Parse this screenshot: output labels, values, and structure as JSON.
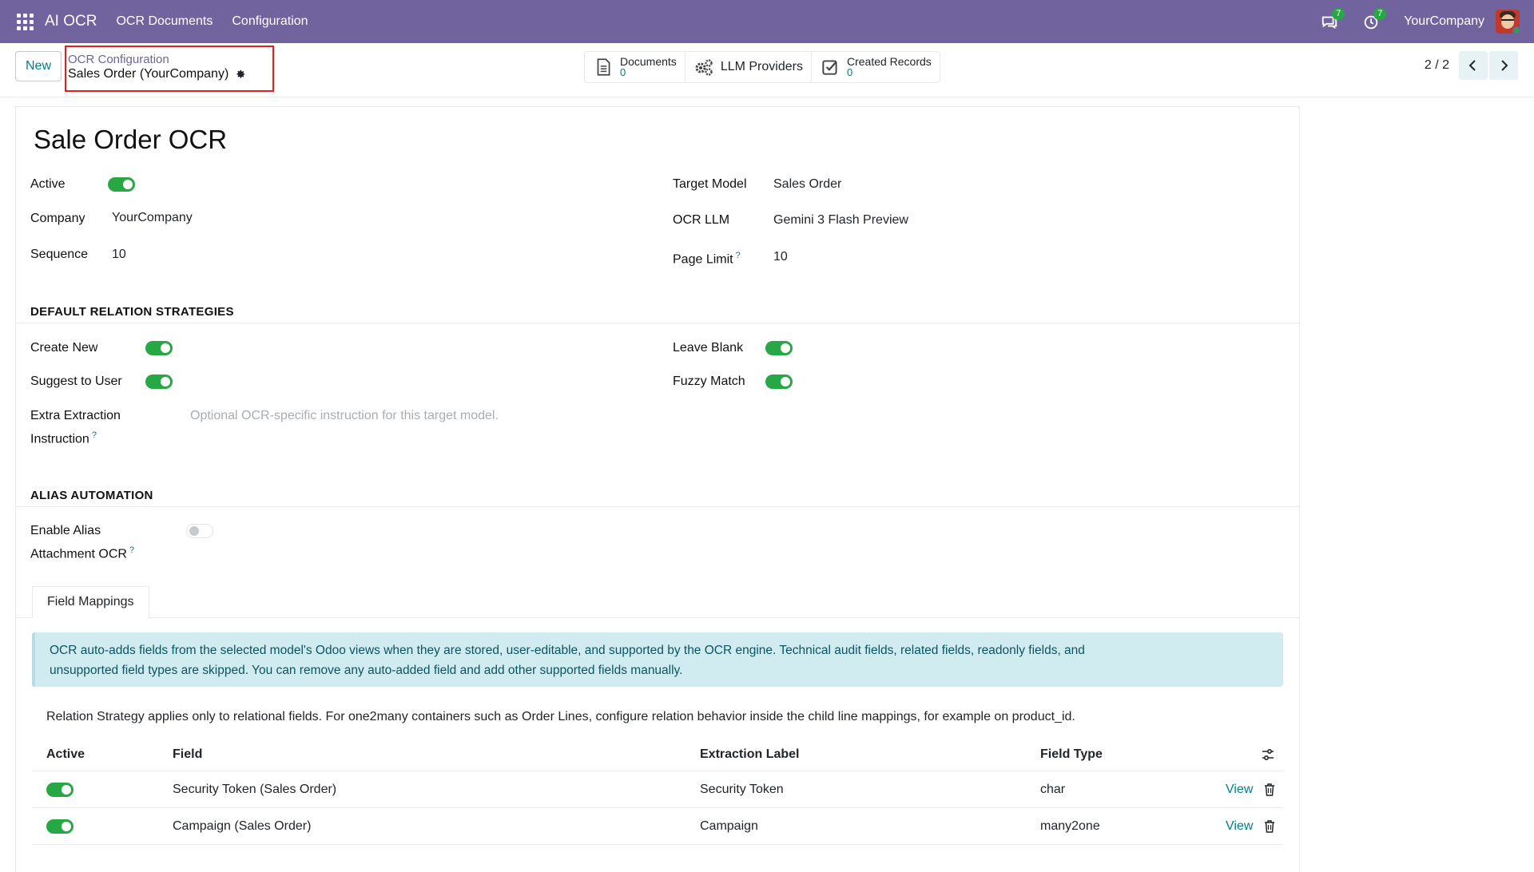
{
  "topbar": {
    "app_name": "AI OCR",
    "menu": [
      "OCR Documents",
      "Configuration"
    ],
    "messages_count": "7",
    "activities_count": "7",
    "company": "YourCompany"
  },
  "control": {
    "new_label": "New",
    "breadcrumb_parent": "OCR Configuration",
    "breadcrumb_current": "Sales Order (YourCompany)",
    "smart_buttons": {
      "documents_label": "Documents",
      "documents_value": "0",
      "llm_label": "LLM Providers",
      "created_label": "Created Records",
      "created_value": "0"
    },
    "pager": "2 / 2"
  },
  "form": {
    "title": "Sale Order OCR",
    "active_label": "Active",
    "active": true,
    "company_label": "Company",
    "company_value": "YourCompany",
    "sequence_label": "Sequence",
    "sequence_value": "10",
    "target_model_label": "Target Model",
    "target_model_value": "Sales Order",
    "ocr_llm_label": "OCR LLM",
    "ocr_llm_value": "Gemini 3 Flash Preview",
    "page_limit_label": "Page Limit",
    "page_limit_value": "10",
    "help_mark": "?"
  },
  "relation_section": {
    "title": "DEFAULT RELATION STRATEGIES",
    "create_new_label": "Create New",
    "create_new": true,
    "suggest_label": "Suggest to User",
    "suggest": true,
    "leave_blank_label": "Leave Blank",
    "leave_blank": true,
    "fuzzy_label": "Fuzzy Match",
    "fuzzy": true,
    "extra_label_line1": "Extra Extraction",
    "extra_label_line2": "Instruction",
    "extra_placeholder": "Optional OCR-specific instruction for this target model."
  },
  "alias_section": {
    "title": "ALIAS AUTOMATION",
    "enable_label_line1": "Enable Alias",
    "enable_label_line2": "Attachment OCR",
    "enabled": false
  },
  "tabs": [
    "Field Mappings"
  ],
  "alert": {
    "line1": "OCR auto-adds fields from the selected model's Odoo views when they are stored, user-editable, and supported by the OCR engine. Technical audit fields, related fields, readonly fields, and",
    "line2": "unsupported field types are skipped. You can remove any auto-added field and add other supported fields manually."
  },
  "info_text": "Relation Strategy applies only to relational fields. For one2many containers such as Order Lines, configure relation behavior inside the child line mappings, for example on product_id.",
  "table": {
    "headers": [
      "Active",
      "Field",
      "Extraction Label",
      "Field Type"
    ],
    "rows": [
      {
        "active": true,
        "field": "Security Token (Sales Order)",
        "label": "Security Token",
        "type": "char",
        "action": "View"
      },
      {
        "active": true,
        "field": "Campaign (Sales Order)",
        "label": "Campaign",
        "type": "many2one",
        "action": "View"
      }
    ]
  },
  "colors": {
    "topbar": "#71639e",
    "accent": "#017e84",
    "toggle_on": "#28a745",
    "alert_bg": "#d1ecf1",
    "highlight_border": "#e02020"
  }
}
